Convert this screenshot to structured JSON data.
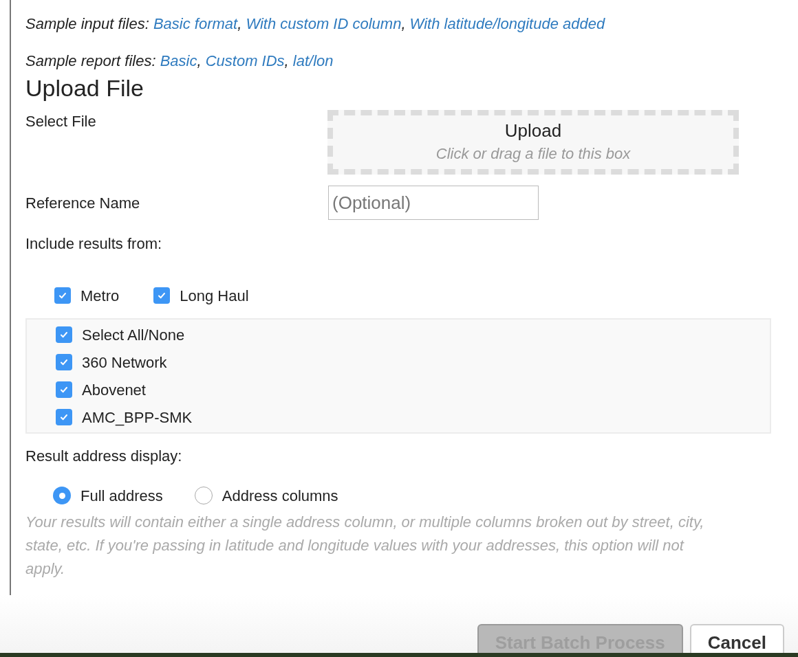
{
  "samples": [
    {
      "label": "Sample input files:",
      "links": [
        "Basic format",
        "With custom ID column",
        "With latitude/longitude added"
      ],
      "separator": ","
    },
    {
      "label": "Sample report files:",
      "links": [
        "Basic",
        "Custom IDs",
        "lat/lon"
      ],
      "separator": ","
    }
  ],
  "heading": "Upload File",
  "select_file": {
    "label": "Select File",
    "title": "Upload",
    "hint": "Click or drag a file to this box"
  },
  "reference_name": {
    "label": "Reference Name",
    "placeholder": "(Optional)"
  },
  "include": {
    "label": "Include results from:",
    "types": [
      {
        "label": "Metro",
        "checked": true
      },
      {
        "label": "Long Haul",
        "checked": true
      }
    ],
    "providers": [
      {
        "label": "Select All/None",
        "checked": true
      },
      {
        "label": "360 Network",
        "checked": true
      },
      {
        "label": "Abovenet",
        "checked": true
      },
      {
        "label": "AMC_BPP-SMK",
        "checked": true
      }
    ]
  },
  "address_display": {
    "label": "Result address display:",
    "options": [
      {
        "label": "Full address",
        "selected": true
      },
      {
        "label": "Address columns",
        "selected": false
      }
    ],
    "help": "Your results will contain either a single address column, or multiple columns broken out by street, city, state, etc. If you're passing in latitude and longitude values with your addresses, this option will not apply."
  },
  "buttons": [
    {
      "label": "Start Batch Process",
      "disabled": true
    },
    {
      "label": "Cancel",
      "disabled": false
    }
  ]
}
